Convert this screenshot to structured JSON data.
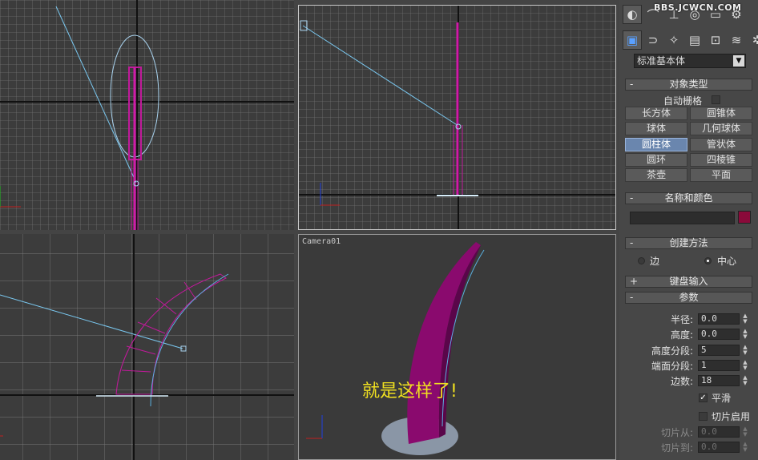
{
  "watermark": "BBS.JCWCN.COM",
  "viewports": {
    "camera_label": "Camera01",
    "annotation": "就是这样了!"
  },
  "panel": {
    "top_tabs": [
      "create-tab-icon",
      "modify-tab-icon",
      "hierarchy-tab-icon",
      "motion-tab-icon",
      "display-tab-icon",
      "utilities-tab-icon"
    ],
    "sub_tabs": [
      "geometry-icon",
      "shapes-icon",
      "lights-icon",
      "cameras-icon",
      "helpers-icon",
      "spacewarps-icon",
      "systems-icon"
    ],
    "dropdown_value": "标准基本体",
    "object_type": {
      "title": "对象类型",
      "sign": "-",
      "autogrid_label": "自动栅格",
      "buttons": [
        "长方体",
        "圆锥体",
        "球体",
        "几何球体",
        "圆柱体",
        "管状体",
        "圆环",
        "四棱锥",
        "茶壶",
        "平面"
      ],
      "active_button": "圆柱体"
    },
    "name_color": {
      "title": "名称和颜色",
      "sign": "-",
      "name_value": "",
      "color": "#8a0a3a"
    },
    "creation_method": {
      "title": "创建方法",
      "sign": "-",
      "edge_label": "边",
      "center_label": "中心",
      "selected": "中心"
    },
    "keyboard_entry": {
      "title": "键盘输入",
      "sign": "+"
    },
    "parameters": {
      "title": "参数",
      "sign": "-",
      "radius_label": "半径:",
      "radius_value": "0.0",
      "height_label": "高度:",
      "height_value": "0.0",
      "height_segs_label": "高度分段:",
      "height_segs_value": "5",
      "cap_segs_label": "端面分段:",
      "cap_segs_value": "1",
      "sides_label": "边数:",
      "sides_value": "18",
      "smooth_label": "平滑",
      "smooth_checked": true,
      "slice_on_label": "切片启用",
      "slice_on_checked": false,
      "slice_from_label": "切片从:",
      "slice_from_value": "0.0",
      "slice_to_label": "切片到:",
      "slice_to_value": "0.0"
    }
  },
  "colors": {
    "object": "#8a0a6e",
    "camera_line": "#7ac8f0",
    "viewport_bg": "#3e3e3e",
    "active_border": "#c8c8c8"
  }
}
